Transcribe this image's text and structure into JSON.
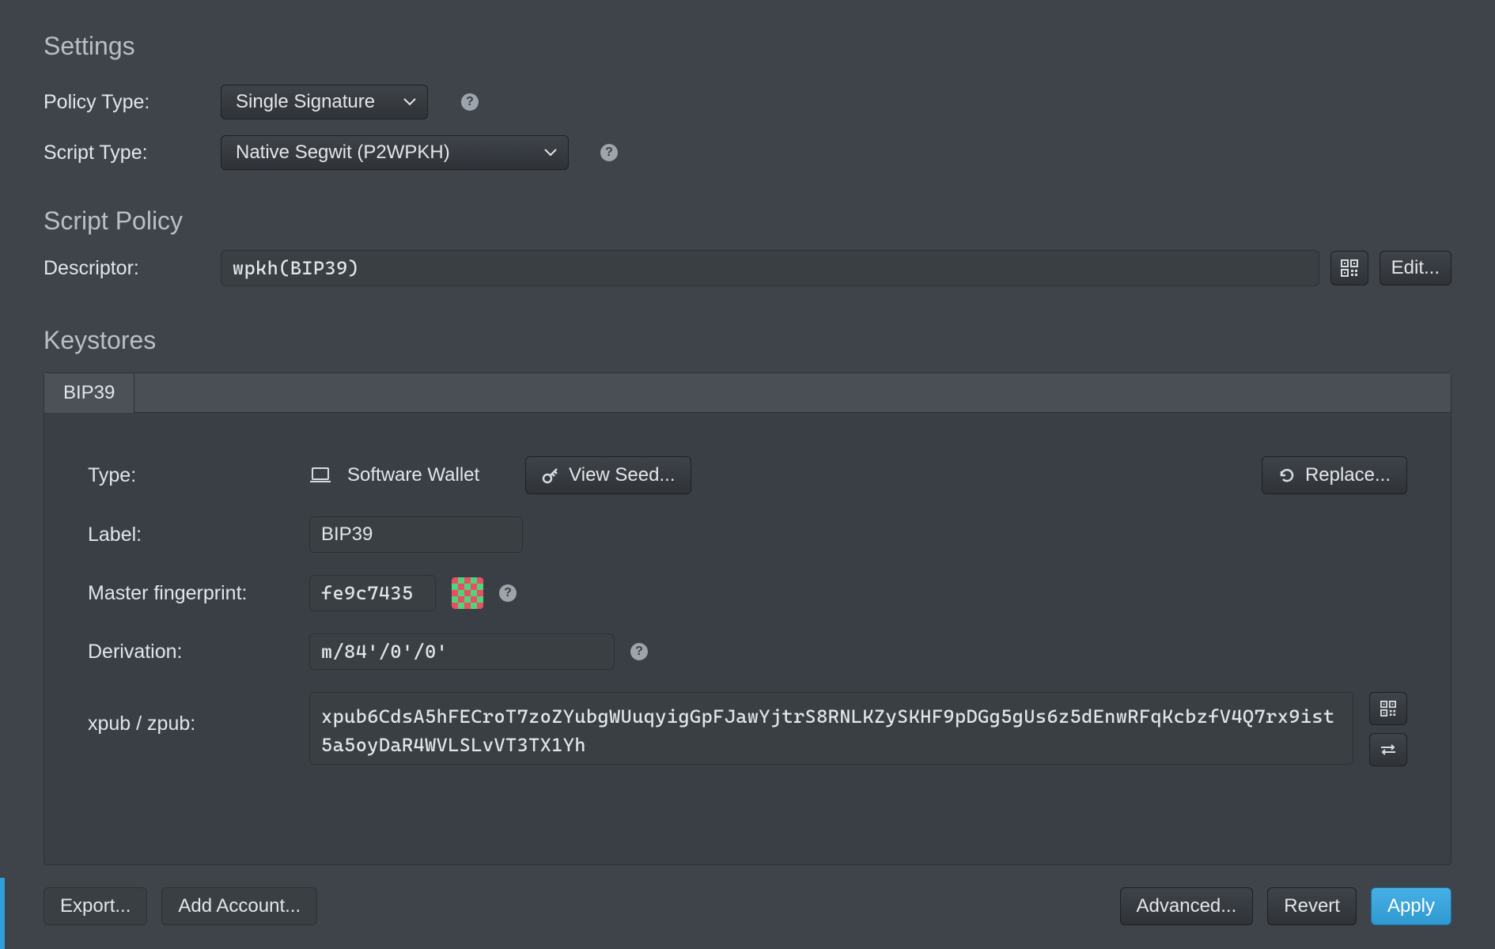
{
  "sections": {
    "settings": "Settings",
    "script_policy": "Script Policy",
    "keystores": "Keystores"
  },
  "settings_panel": {
    "policy_type_label": "Policy Type:",
    "policy_type_value": "Single Signature",
    "script_type_label": "Script Type:",
    "script_type_value": "Native Segwit (P2WPKH)"
  },
  "script_policy": {
    "descriptor_label": "Descriptor:",
    "descriptor_value": "wpkh(BIP39)",
    "edit_button": "Edit..."
  },
  "keystore": {
    "tab_label": "BIP39",
    "type_label": "Type:",
    "type_value": "Software Wallet",
    "view_seed_button": "View Seed...",
    "replace_button": "Replace...",
    "label_label": "Label:",
    "label_value": "BIP39",
    "fingerprint_label": "Master fingerprint:",
    "fingerprint_value": "fe9c7435",
    "derivation_label": "Derivation:",
    "derivation_value": "m/84'/0'/0'",
    "xpub_label": "xpub / zpub:",
    "xpub_value": "xpub6CdsA5hFECroT7zoZYubgWUuqyigGpFJawYjtrS8RNLKZySKHF9pDGg5gUs6z5dEnwRFqKcbzfV4Q7rx9ist5a5oyDaR4WVLSLvVT3TX1Yh"
  },
  "footer": {
    "export_button": "Export...",
    "add_account_button": "Add Account...",
    "advanced_button": "Advanced...",
    "revert_button": "Revert",
    "apply_button": "Apply"
  }
}
